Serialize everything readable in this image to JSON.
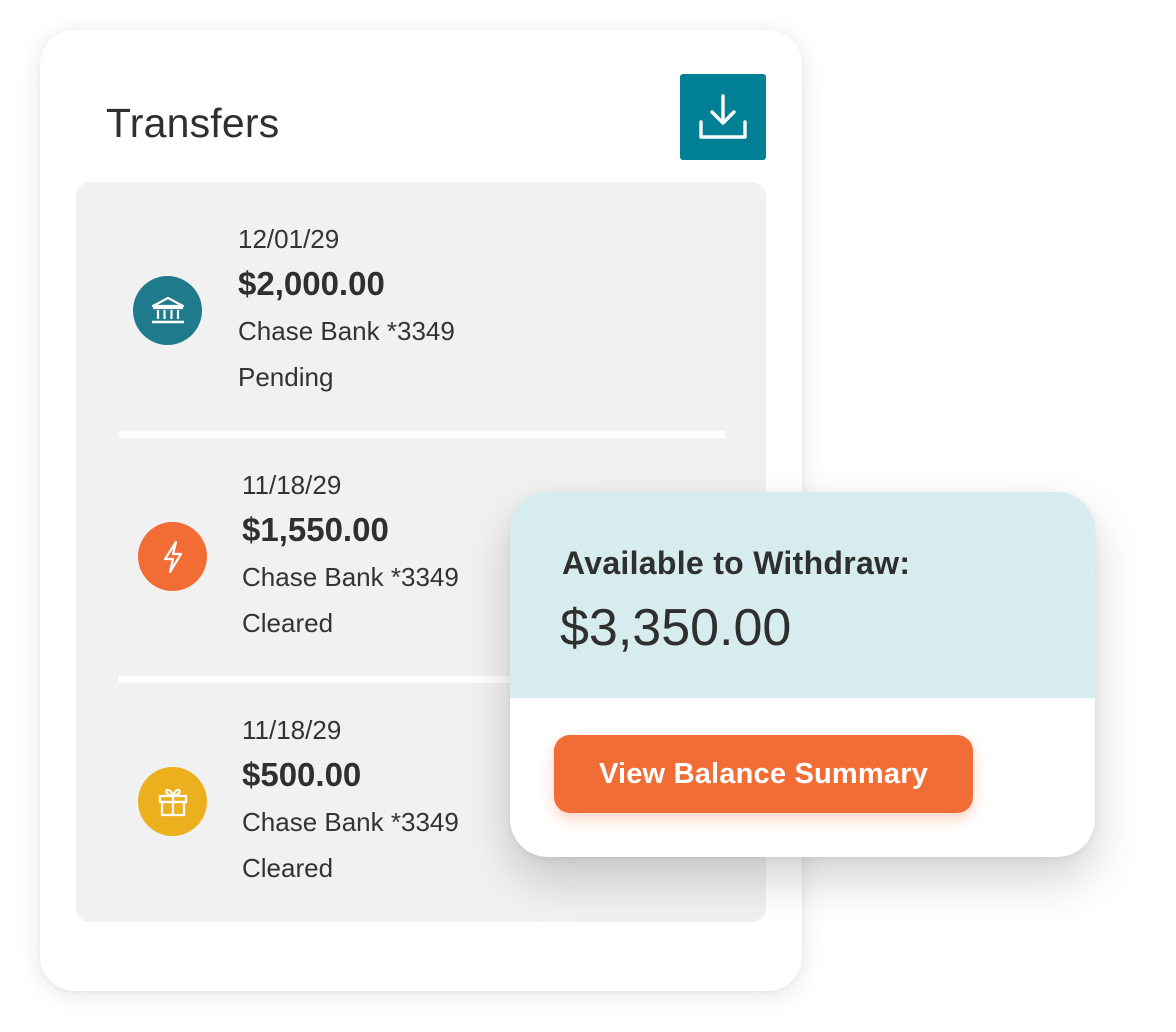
{
  "transfers_card": {
    "title": "Transfers",
    "download_icon": "download-icon",
    "items": [
      {
        "date": "12/01/29",
        "amount": "$2,000.00",
        "account": "Chase Bank *3349",
        "status": "Pending",
        "icon": "bank-icon",
        "icon_color": "#1f7a8c"
      },
      {
        "date": "11/18/29",
        "amount": "$1,550.00",
        "account": "Chase Bank *3349",
        "status": "Cleared",
        "icon": "lightning-icon",
        "icon_color": "#f26c35"
      },
      {
        "date": "11/18/29",
        "amount": "$500.00",
        "account": "Chase Bank *3349",
        "status": "Cleared",
        "icon": "gift-icon",
        "icon_color": "#ecb01f"
      }
    ]
  },
  "balance_card": {
    "label": "Available to Withdraw:",
    "amount": "$3,350.00",
    "button_label": "View Balance Summary"
  },
  "colors": {
    "teal": "#007f95",
    "orange": "#f26c35",
    "yellow": "#ecb01f",
    "light_teal_bg": "#d6ecee",
    "list_bg": "#f1f1f1"
  }
}
